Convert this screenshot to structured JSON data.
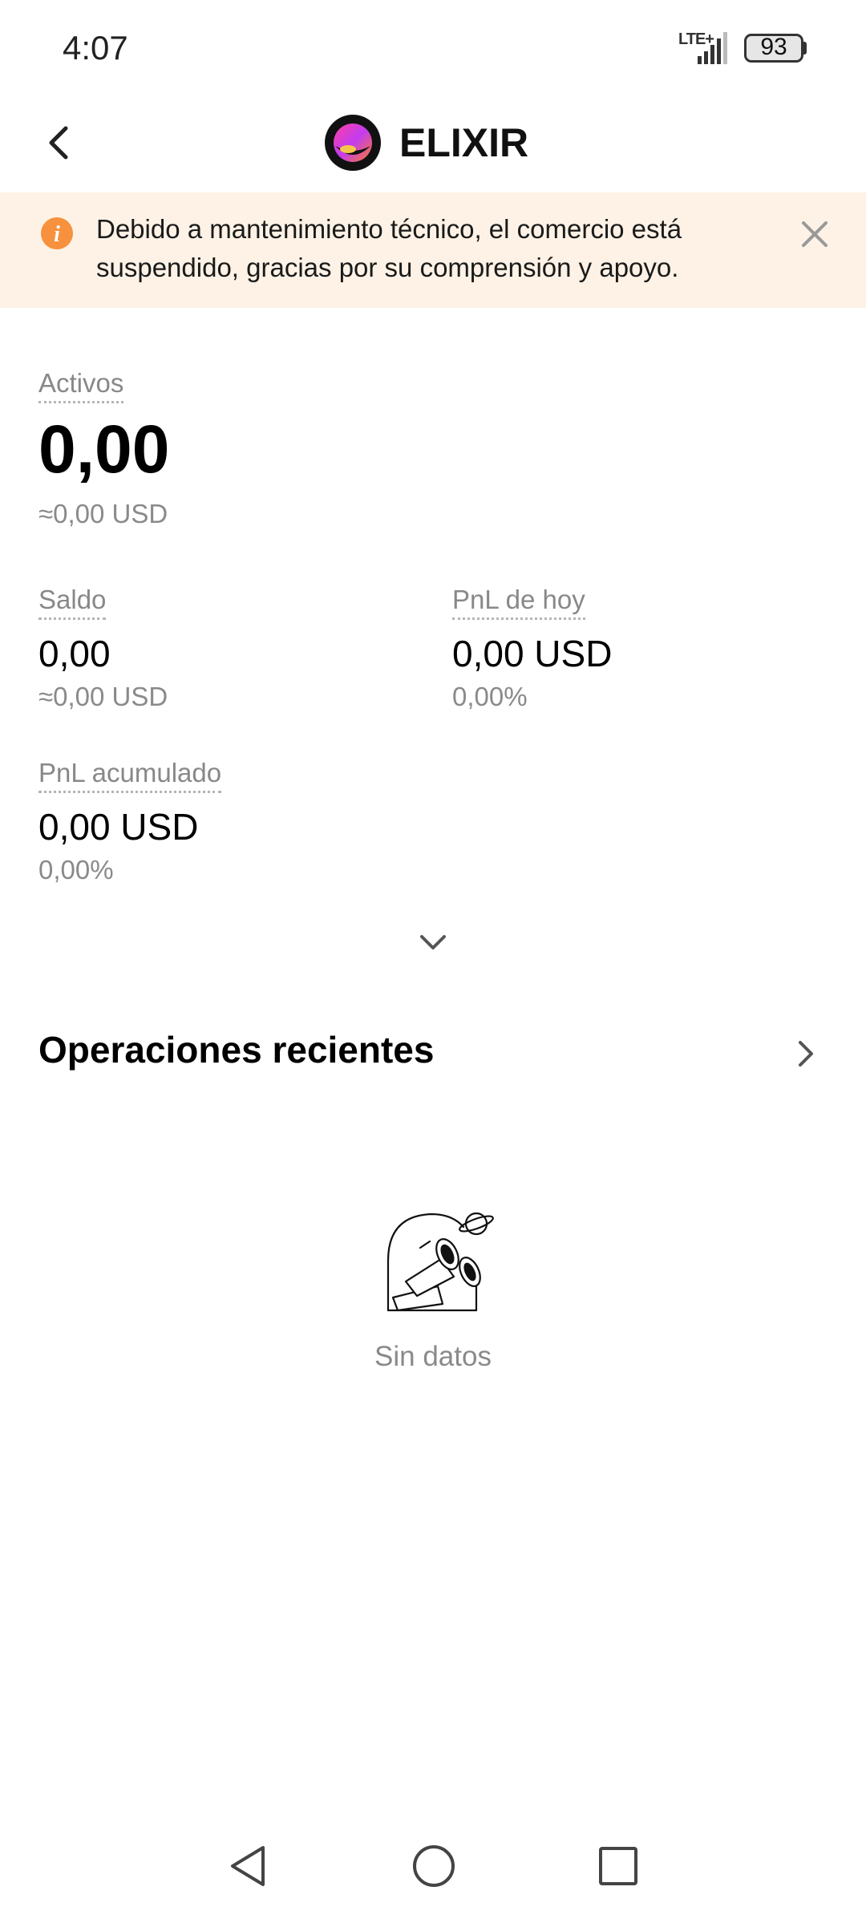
{
  "status_bar": {
    "time": "4:07",
    "network": "LTE+",
    "battery": "93"
  },
  "header": {
    "title": "ELIXIR",
    "back_icon": "chevron-left-icon",
    "logo_icon": "elixir-token-logo"
  },
  "notice": {
    "text": "Debido a mantenimiento técnico, el comercio está suspendido, gracias por su comprensión y apoyo.",
    "icon": "info-icon",
    "close_icon": "close-icon",
    "accent": "#f7913d",
    "background": "#fdf2e5"
  },
  "assets": {
    "label": "Activos",
    "value": "0,00",
    "usd": "≈0,00 USD"
  },
  "balance": {
    "label": "Saldo",
    "value": "0,00",
    "usd": "≈0,00 USD"
  },
  "pnl_today": {
    "label": "PnL de hoy",
    "value": "0,00 USD",
    "percent": "0,00%"
  },
  "pnl_cumulative": {
    "label": "PnL acumulado",
    "value": "0,00 USD",
    "percent": "0,00%"
  },
  "recent_ops": {
    "title": "Operaciones recientes",
    "empty_text": "Sin datos",
    "empty_icon": "binoculars-illustration"
  },
  "nav": {
    "back": "nav-back-icon",
    "home": "nav-home-icon",
    "recent": "nav-recent-icon"
  }
}
